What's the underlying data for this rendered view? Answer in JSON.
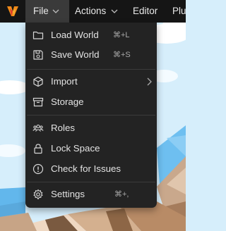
{
  "menubar": {
    "items": [
      {
        "label": "File"
      },
      {
        "label": "Actions"
      },
      {
        "label": "Editor"
      },
      {
        "label": "Plu"
      }
    ]
  },
  "file_menu": {
    "items": [
      {
        "label": "Load World",
        "shortcut": "⌘+L",
        "icon": "folder-icon"
      },
      {
        "label": "Save World",
        "shortcut": "⌘+S",
        "icon": "save-icon"
      },
      {
        "label": "Import",
        "icon": "cube-icon",
        "submenu": true
      },
      {
        "label": "Storage",
        "icon": "archive-icon"
      },
      {
        "label": "Roles",
        "icon": "users-icon"
      },
      {
        "label": "Lock Space",
        "icon": "lock-icon"
      },
      {
        "label": "Check for Issues",
        "icon": "alert-circle-icon"
      },
      {
        "label": "Settings",
        "shortcut": "⌘+,",
        "icon": "gear-icon"
      }
    ]
  },
  "colors": {
    "menubar_bg": "#151515",
    "active_item_bg": "#3a3a3a",
    "menu_bg": "#232323",
    "menu_text": "#e3e3e3",
    "sky": "#d6eefb",
    "logo_orange": "#f08a19",
    "logo_red": "#e23b2e"
  }
}
